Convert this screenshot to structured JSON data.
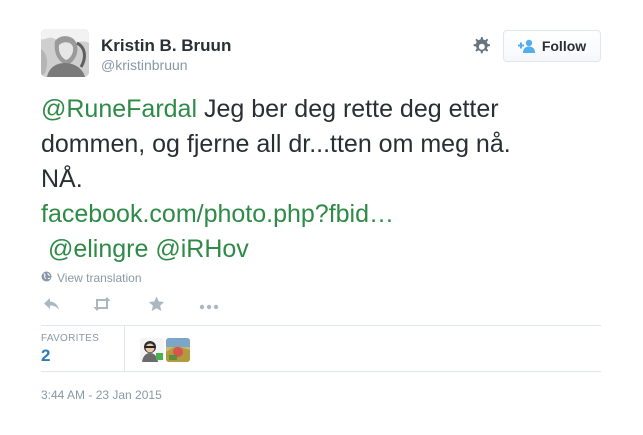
{
  "user": {
    "fullname": "Kristin B. Bruun",
    "screenname": "@kristinbruun"
  },
  "header": {
    "follow_label": "Follow"
  },
  "tweet": {
    "mention_1": "@RuneFardal",
    "text_1": " Jeg ber deg rette deg etter",
    "text_2": "dommen, og fjerne all dr...tten om meg nå.",
    "text_3": "NÅ.",
    "link": "facebook.com/photo.php?fbid…",
    "mention_2": "@elingre",
    "mention_3": "@iRHov"
  },
  "translate_label": "View translation",
  "actions": {
    "reply": "reply-icon",
    "retweet": "retweet-icon",
    "favorite": "star-icon",
    "more": "more-icon"
  },
  "stats": {
    "label": "FAVORITES",
    "count": "2"
  },
  "timestamp": "3:44 AM - 23 Jan 2015",
  "colors": {
    "link_blue": "#2b7bb9",
    "mention_green": "#2e8b47",
    "muted": "#8899a6",
    "text": "#292f33"
  }
}
